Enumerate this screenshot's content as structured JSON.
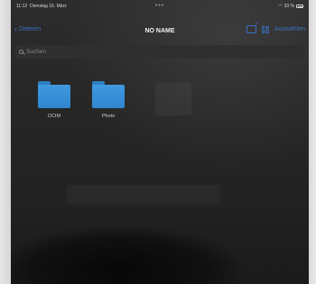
{
  "status_bar": {
    "time": "11:12",
    "date": "Dienstag 16. März",
    "battery": "33 %"
  },
  "nav": {
    "back_label": "Dateien",
    "title": "NO NAME",
    "select_label": "Auswählen"
  },
  "search": {
    "placeholder": "Suchen"
  },
  "folders": [
    {
      "name": "DCIM",
      "icon": "folder-icon"
    },
    {
      "name": "Photo",
      "icon": "folder-icon"
    }
  ],
  "colors": {
    "accent": "#3a6fc0",
    "folder": "#3f9ae0",
    "background": "#262626"
  }
}
